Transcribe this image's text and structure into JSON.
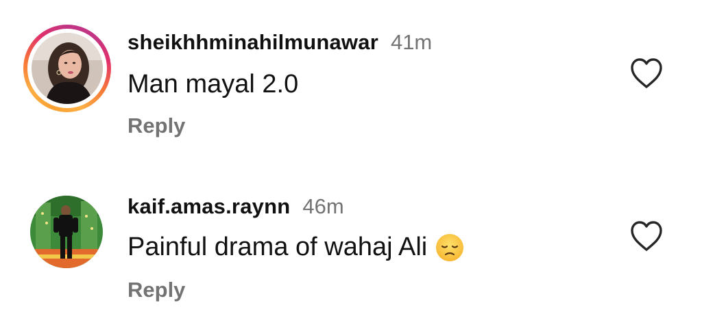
{
  "comments": [
    {
      "username": "sheikhhminahilmunawar",
      "time": "41m",
      "text": "Man mayal 2.0",
      "emoji": "",
      "reply_label": "Reply",
      "avatar_icon": "avatar-story-ring",
      "like_icon": "heart-outline-icon"
    },
    {
      "username": "kaif.amas.raynn",
      "time": "46m",
      "text": "Painful drama of wahaj Ali",
      "emoji": "disappointed-face",
      "reply_label": "Reply",
      "avatar_icon": "avatar",
      "like_icon": "heart-outline-icon"
    }
  ],
  "colors": {
    "username": "#111111",
    "meta": "#737373",
    "story_ring_start": "#fcaf45",
    "story_ring_end": "#c13584"
  }
}
